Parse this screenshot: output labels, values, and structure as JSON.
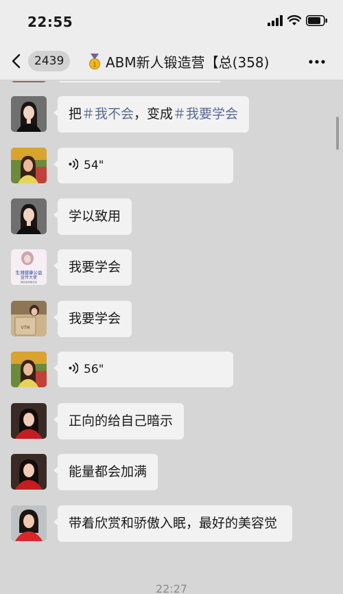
{
  "status_bar": {
    "time": "22:55"
  },
  "nav": {
    "unread_count": "2439",
    "title": "ABM新人锻造营【总",
    "member_count": "(358)"
  },
  "messages": [
    {
      "kind": "text",
      "segments": [
        {
          "text": "把",
          "tag": false
        },
        {
          "text": "＃我不会",
          "tag": true
        },
        {
          "text": "，变成",
          "tag": false
        },
        {
          "text": "＃我要学会",
          "tag": true
        }
      ]
    },
    {
      "kind": "voice",
      "duration": "54\""
    },
    {
      "kind": "text",
      "text": "学以致用"
    },
    {
      "kind": "text",
      "text": "我要学会"
    },
    {
      "kind": "text",
      "text": "我要学会"
    },
    {
      "kind": "voice",
      "duration": "56\""
    },
    {
      "kind": "text",
      "text": "正向的给自己暗示"
    },
    {
      "kind": "text",
      "text": "能量都会加满"
    },
    {
      "kind": "text",
      "text": "带着欣赏和骄傲入眠，最好的美容觉"
    }
  ],
  "avatar_cards": {
    "line1": "生湘健康公益",
    "line2": "宣传大使",
    "line3": "湖南省健康协会"
  },
  "avatar_bag_text": "VTM",
  "timestamp": "22:27",
  "colors": {
    "background": "#d6d6d6",
    "header": "#ededed",
    "bubble": "#f2f2f2",
    "hashtag": "#576b95"
  }
}
